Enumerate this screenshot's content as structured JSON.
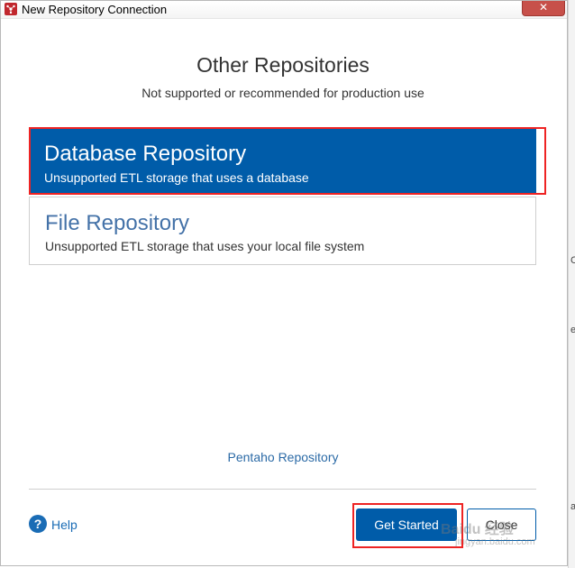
{
  "window": {
    "title": "New Repository Connection",
    "close_glyph": "✕",
    "icon": "pentaho-logo-icon"
  },
  "header": {
    "title": "Other Repositories",
    "subtitle": "Not supported or recommended for production use"
  },
  "repositories": [
    {
      "name": "Database Repository",
      "description": "Unsupported ETL storage that uses a database",
      "selected": true
    },
    {
      "name": "File Repository",
      "description": "Unsupported ETL storage that uses your local file system",
      "selected": false
    }
  ],
  "footer": {
    "pentaho_link": "Pentaho Repository",
    "help_glyph": "?",
    "help_label": "Help",
    "get_started_label": "Get Started",
    "close_label": "Close"
  },
  "watermark": {
    "line1": "Baidu 经验",
    "line2": "jingyan.baidu.com"
  },
  "background_fragments": [
    "C",
    "e",
    "a"
  ],
  "colors": {
    "accent": "#005ca9",
    "link": "#2b6aa6",
    "highlight": "#ee2323"
  }
}
